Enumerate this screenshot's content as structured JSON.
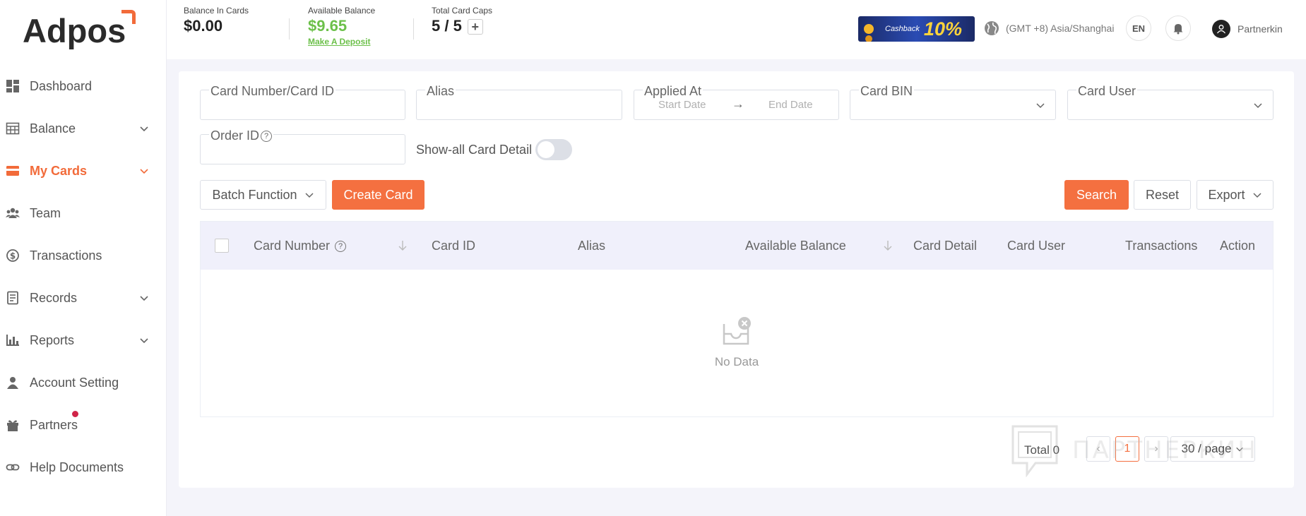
{
  "sidebar": {
    "logo": "Adpos",
    "items": [
      {
        "label": "Dashboard",
        "has_chevron": false
      },
      {
        "label": "Balance",
        "has_chevron": true
      },
      {
        "label": "My Cards",
        "has_chevron": true,
        "active": true
      },
      {
        "label": "Team",
        "has_chevron": false
      },
      {
        "label": "Transactions",
        "has_chevron": false
      },
      {
        "label": "Records",
        "has_chevron": true
      },
      {
        "label": "Reports",
        "has_chevron": true
      },
      {
        "label": "Account Setting",
        "has_chevron": false
      },
      {
        "label": "Partners",
        "has_chevron": false,
        "badge_dot": true
      },
      {
        "label": "Help Documents",
        "has_chevron": false
      }
    ]
  },
  "header": {
    "balance_in_cards": {
      "label": "Balance In Cards",
      "value": "$0.00"
    },
    "available_balance": {
      "label": "Available Balance",
      "value": "$9.65",
      "link": "Make A Deposit"
    },
    "total_card_caps": {
      "label": "Total Card Caps",
      "value": "5 / 5",
      "plus": "+"
    },
    "promo": {
      "text": "Cashback",
      "percent": "10%"
    },
    "timezone": "(GMT +8) Asia/Shanghai",
    "language": "EN",
    "username": "Partnerkin"
  },
  "filters": {
    "card_number": {
      "label": "Card Number/Card ID"
    },
    "alias": {
      "label": "Alias"
    },
    "applied_at": {
      "label": "Applied At",
      "start_placeholder": "Start Date",
      "end_placeholder": "End Date",
      "arrow": "→"
    },
    "card_bin": {
      "label": "Card BIN"
    },
    "card_user": {
      "label": "Card User"
    },
    "order_id": {
      "label": "Order ID",
      "help": "?"
    },
    "show_all": {
      "label": "Show-all Card Detail",
      "on": false
    }
  },
  "actions": {
    "batch": "Batch Function",
    "create": "Create Card",
    "search": "Search",
    "reset": "Reset",
    "export": "Export"
  },
  "table": {
    "columns": [
      "Card Number",
      "Card ID",
      "Alias",
      "Available Balance",
      "Card Detail",
      "Card User",
      "Transactions",
      "Action"
    ],
    "card_number_help": "?",
    "empty_text": "No Data"
  },
  "pagination": {
    "total": "Total 0",
    "prev": "‹",
    "current": "1",
    "next": "›",
    "per_page": "30 / page"
  },
  "watermark": "ПАРТНЕРКИН",
  "colors": {
    "accent": "#f47040",
    "green": "#6cc04a",
    "header_bg": "#f0f0fb"
  }
}
